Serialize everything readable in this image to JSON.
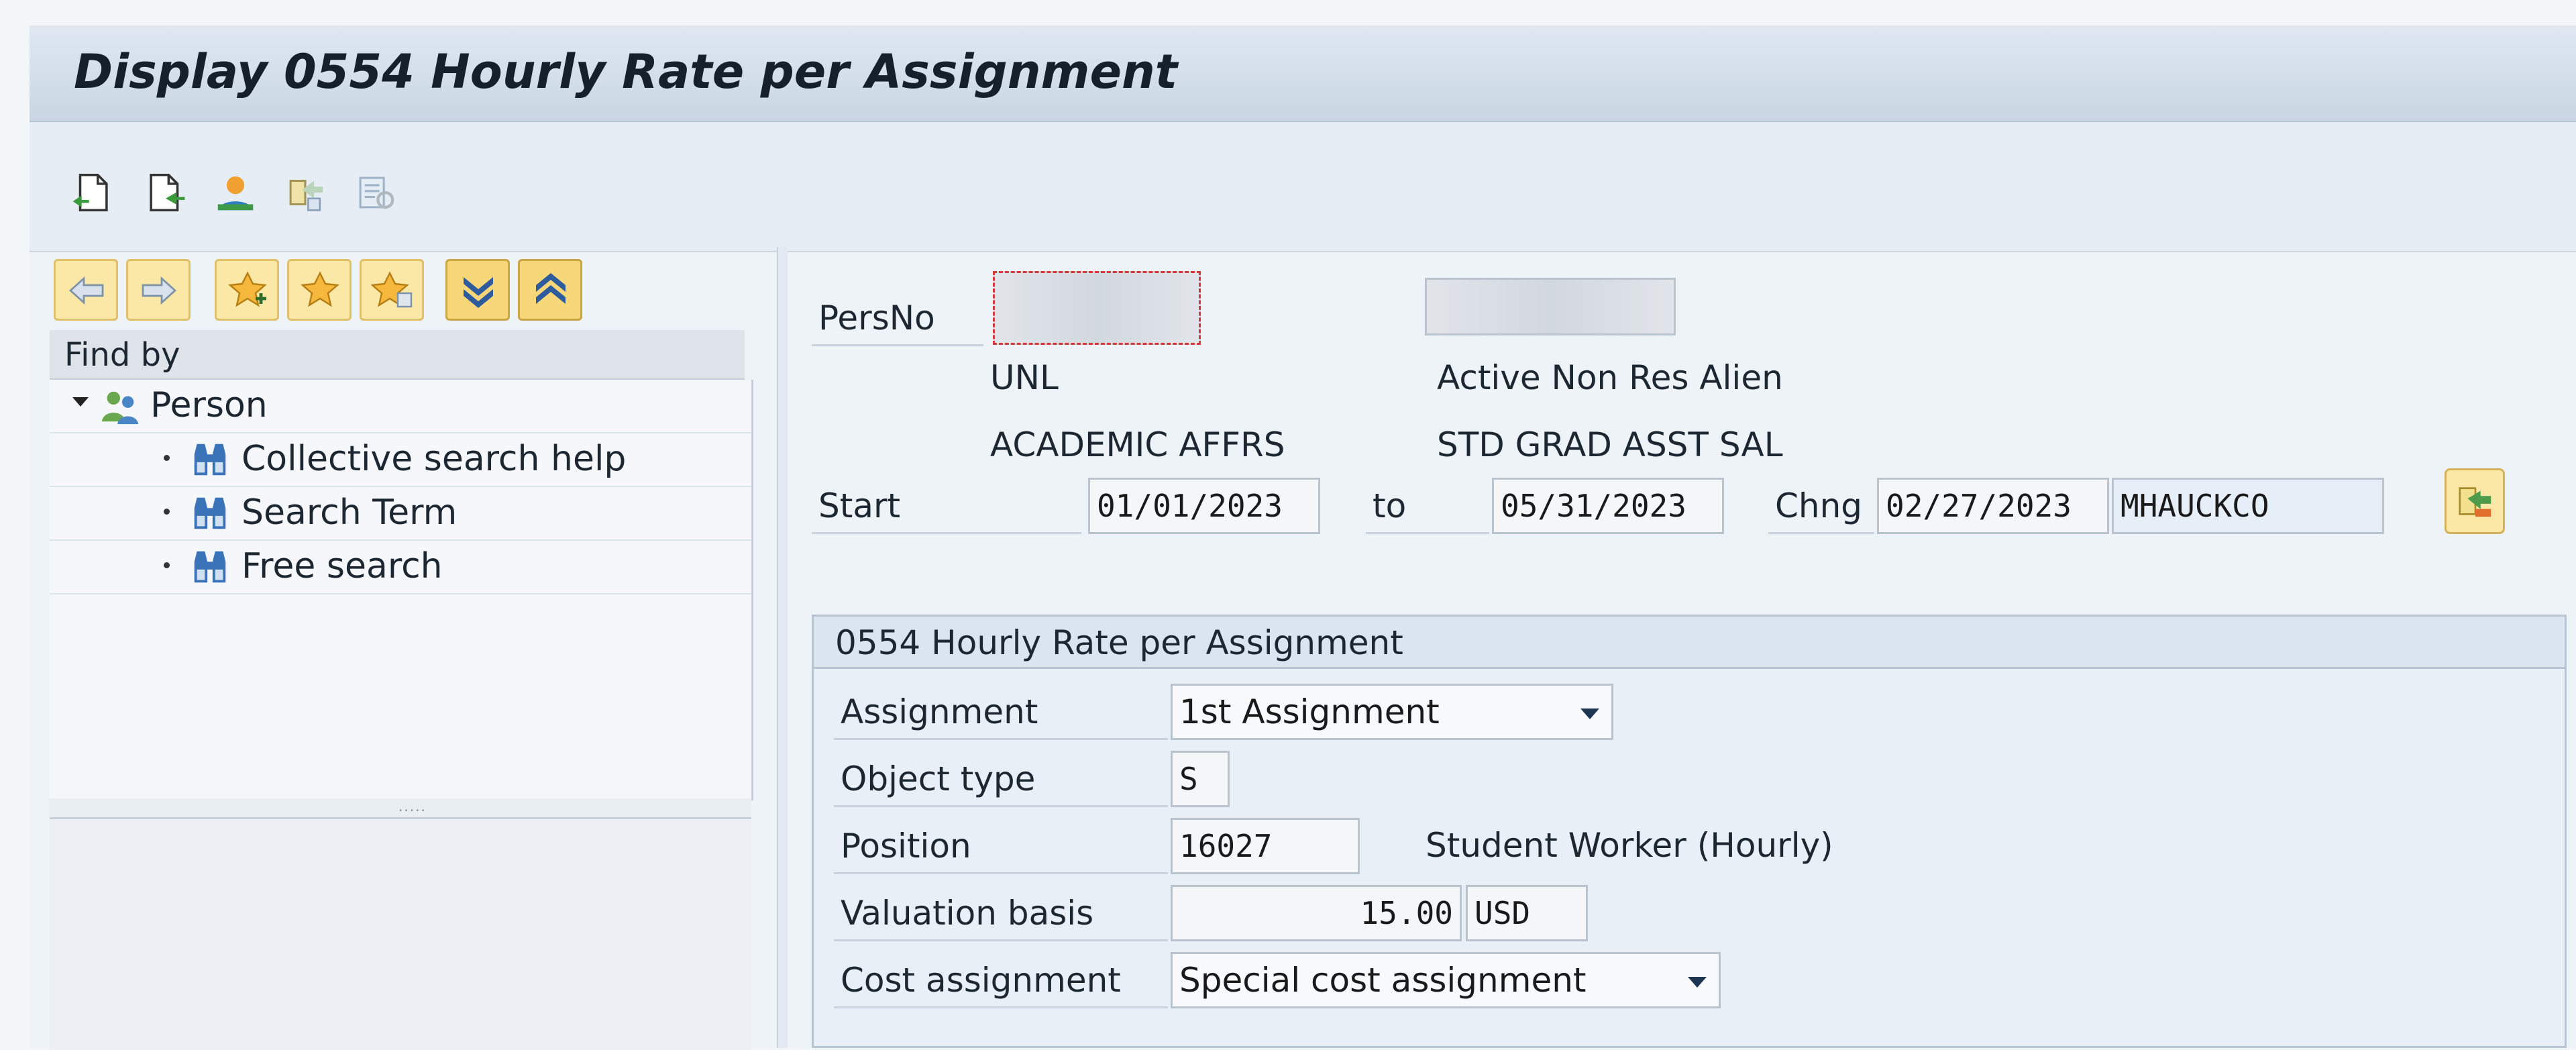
{
  "window": {
    "title": "Display 0554 Hourly Rate per Assignment"
  },
  "app_toolbar": {
    "icons": [
      "new-document-icon",
      "copy-document-icon",
      "person-overview-icon",
      "transfer-icon",
      "overview-icon"
    ]
  },
  "left_pane": {
    "nav_buttons": [
      "arrow-left-icon",
      "arrow-right-icon",
      "add-favorite-icon",
      "favorite-icon",
      "edit-favorite-icon",
      "expand-down-icon",
      "collapse-up-icon"
    ],
    "find_by_label": "Find by",
    "tree": {
      "root": "Person",
      "children": [
        "Collective search help",
        "Search Term",
        "Free search"
      ]
    }
  },
  "header": {
    "persno_label": "PersNo",
    "company": "UNL",
    "status": "Active Non Res Alien",
    "org_unit": "ACADEMIC AFFRS",
    "employee_subgroup": "STD GRAD ASST SAL",
    "start_label": "Start",
    "start_date": "01/01/2023",
    "to_label": "to",
    "end_date": "05/31/2023",
    "chng_label": "Chng",
    "chng_date": "02/27/2023",
    "chng_user": "MHAUCKCO"
  },
  "infotype": {
    "group_title": "0554 Hourly Rate per Assignment",
    "assignment_label": "Assignment",
    "assignment_value": "1st Assignment",
    "object_type_label": "Object type",
    "object_type_value": "S",
    "position_label": "Position",
    "position_value": "16027",
    "position_text": "Student Worker (Hourly)",
    "valuation_label": "Valuation basis",
    "valuation_value": "15.00",
    "currency": "USD",
    "cost_label": "Cost assignment",
    "cost_value": "Special cost assignment"
  }
}
